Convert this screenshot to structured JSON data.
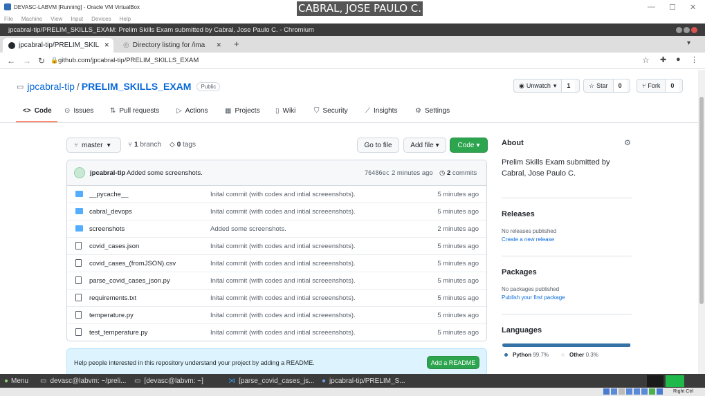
{
  "vbox": {
    "title": "DEVASC-LABVM [Running] - Oracle VM VirtualBox",
    "menu": [
      "File",
      "Machine",
      "View",
      "Input",
      "Devices",
      "Help"
    ],
    "overlay_name": "CABRAL, JOSE PAULO C.",
    "host_key": "Right Ctrl"
  },
  "browser": {
    "window_title": "jpcabral-tip/PRELIM_SKILLS_EXAM: Prelim Skills Exam submitted by Cabral, Jose Paulo C. - Chromium",
    "tabs": [
      {
        "label": "jpcabral-tip/PRELIM_SKIL"
      },
      {
        "label": "Directory listing for /ima"
      }
    ],
    "url": "github.com/jpcabral-tip/PRELIM_SKILLS_EXAM"
  },
  "repo": {
    "owner": "jpcabral-tip",
    "separator": "/",
    "name": "PRELIM_SKILLS_EXAM",
    "visibility": "Public",
    "unwatch_label": "Unwatch",
    "watch_count": "1",
    "star_label": "Star",
    "star_count": "0",
    "fork_label": "Fork",
    "fork_count": "0"
  },
  "nav": {
    "code": "Code",
    "issues": "Issues",
    "pulls": "Pull requests",
    "actions": "Actions",
    "projects": "Projects",
    "wiki": "Wiki",
    "security": "Security",
    "insights": "Insights",
    "settings": "Settings"
  },
  "toolbar": {
    "branch": "master",
    "branch_count": "1",
    "branch_word": "branch",
    "tag_count": "0",
    "tag_word": "tags",
    "go_to_file": "Go to file",
    "add_file": "Add file",
    "code": "Code"
  },
  "commit": {
    "author": "jpcabral-tip",
    "message": "Added some screenshots.",
    "sha": "76486ec",
    "time": "2 minutes ago",
    "count": "2",
    "count_word": "commits"
  },
  "files": [
    {
      "type": "dir",
      "name": "__pycache__",
      "message": "Inital commit (with codes and intial screeenshots).",
      "age": "5 minutes ago"
    },
    {
      "type": "dir",
      "name": "cabral_devops",
      "message": "Inital commit (with codes and intial screeenshots).",
      "age": "5 minutes ago"
    },
    {
      "type": "dir",
      "name": "screenshots",
      "message": "Added some screenshots.",
      "age": "2 minutes ago"
    },
    {
      "type": "file",
      "name": "covid_cases.json",
      "message": "Inital commit (with codes and intial screeenshots).",
      "age": "5 minutes ago"
    },
    {
      "type": "file",
      "name": "covid_cases_(fromJSON).csv",
      "message": "Inital commit (with codes and intial screeenshots).",
      "age": "5 minutes ago"
    },
    {
      "type": "file",
      "name": "parse_covid_cases_json.py",
      "message": "Inital commit (with codes and intial screeenshots).",
      "age": "5 minutes ago"
    },
    {
      "type": "file",
      "name": "requirements.txt",
      "message": "Inital commit (with codes and intial screeenshots).",
      "age": "5 minutes ago"
    },
    {
      "type": "file",
      "name": "temperature.py",
      "message": "Inital commit (with codes and intial screeenshots).",
      "age": "5 minutes ago"
    },
    {
      "type": "file",
      "name": "test_temperature.py",
      "message": "Inital commit (with codes and intial screeenshots).",
      "age": "5 minutes ago"
    }
  ],
  "readme": {
    "text": "Help people interested in this repository understand your project by adding a README.",
    "button": "Add a README"
  },
  "about": {
    "heading": "About",
    "description": "Prelim Skills Exam submitted by Cabral, Jose Paulo C.",
    "releases_heading": "Releases",
    "releases_text": "No releases published",
    "releases_link": "Create a new release",
    "packages_heading": "Packages",
    "packages_text": "No packages published",
    "packages_link": "Publish your first package",
    "languages_heading": "Languages",
    "languages": [
      {
        "name": "Python",
        "percent": "99.7%",
        "color": "#3572A5",
        "share": 0.997
      },
      {
        "name": "Other",
        "percent": "0.3%",
        "color": "#ededed",
        "share": 0.003
      }
    ]
  },
  "taskbar": {
    "menu": "Menu",
    "items": [
      "devasc@labvm: ~/preli...",
      "[devasc@labvm: ~]",
      "[parse_covid_cases_js...",
      "jpcabral-tip/PRELIM_S..."
    ]
  },
  "colors": {
    "accent": "#0969da",
    "green": "#2da44e",
    "nav_underline": "#fd8c73"
  }
}
